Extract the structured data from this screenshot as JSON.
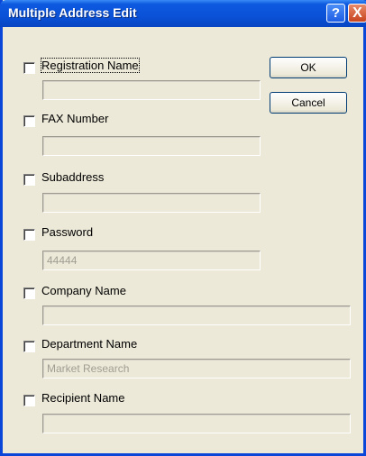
{
  "window": {
    "title": "Multiple Address Edit"
  },
  "titlebar_buttons": {
    "help": "?",
    "close": "X"
  },
  "buttons": {
    "ok": "OK",
    "cancel": "Cancel"
  },
  "fields": [
    {
      "label": "Registration Name",
      "value": "",
      "checked": false
    },
    {
      "label": "FAX Number",
      "value": "",
      "checked": false
    },
    {
      "label": "Subaddress",
      "value": "",
      "checked": false
    },
    {
      "label": "Password",
      "value": "44444",
      "checked": false
    },
    {
      "label": "Company Name",
      "value": "",
      "checked": false
    },
    {
      "label": "Department Name",
      "value": "Market Research",
      "checked": false
    },
    {
      "label": "Recipient Name",
      "value": "",
      "checked": false
    }
  ]
}
